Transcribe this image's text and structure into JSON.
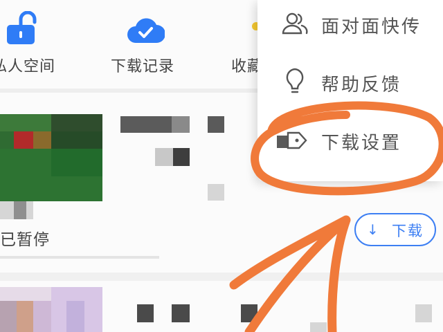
{
  "shortcuts": [
    {
      "label": "私人空间",
      "icon": "lock-icon"
    },
    {
      "label": "下载记录",
      "icon": "cloud-check-icon"
    },
    {
      "label": "收藏",
      "icon": "star-icon"
    }
  ],
  "list": {
    "item1": {
      "status": "已暂停",
      "download_label": "下载"
    }
  },
  "menu": {
    "items": [
      {
        "label": "面对面快传",
        "icon": "users-icon"
      },
      {
        "label": "帮助反馈",
        "icon": "lightbulb-icon"
      },
      {
        "label": "下载设置",
        "icon": "tag-icon"
      }
    ]
  },
  "colors": {
    "accent": "#3d7ff3",
    "annotation": "#f07a3a"
  }
}
